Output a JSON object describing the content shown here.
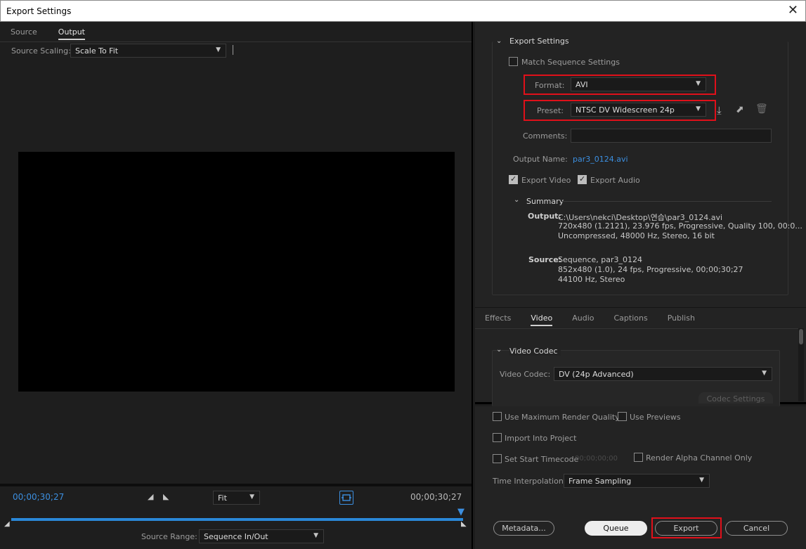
{
  "window": {
    "title": "Export Settings",
    "close_icon": "close-icon"
  },
  "left": {
    "tabs": [
      "Source",
      "Output"
    ],
    "active_tab": 1,
    "source_scaling_label": "Source Scaling:",
    "source_scaling_value": "Scale To Fit",
    "timecode_left": "00;00;30;27",
    "timecode_right": "00;00;30;27",
    "zoom_value": "Fit",
    "source_range_label": "Source Range:",
    "source_range_value": "Sequence In/Out"
  },
  "export_settings": {
    "section_title": "Export Settings",
    "match_sequence_label": "Match Sequence Settings",
    "format_label": "Format:",
    "format_value": "AVI",
    "preset_label": "Preset:",
    "preset_value": "NTSC DV Widescreen 24p",
    "comments_label": "Comments:",
    "comments_value": "",
    "output_name_label": "Output Name:",
    "output_name_value": "par3_0124.avi",
    "export_video_label": "Export Video",
    "export_audio_label": "Export Audio",
    "summary": {
      "title": "Summary",
      "output_label": "Output:",
      "output_lines": [
        "C:\\Users\\nekci\\Desktop\\연습\\par3_0124.avi",
        "720x480 (1.2121), 23.976 fps, Progressive, Quality 100, 00:0...",
        "Uncompressed, 48000 Hz, Stereo, 16 bit"
      ],
      "source_label": "Source:",
      "source_lines": [
        "Sequence, par3_0124",
        "852x480 (1.0), 24 fps, Progressive, 00;00;30;27",
        "44100 Hz, Stereo"
      ]
    }
  },
  "settings_tabs": {
    "items": [
      "Effects",
      "Video",
      "Audio",
      "Captions",
      "Publish"
    ],
    "active": 1
  },
  "video_codec": {
    "section_title": "Video Codec",
    "codec_label": "Video Codec:",
    "codec_value": "DV (24p Advanced)",
    "codec_settings_button": "Codec Settings"
  },
  "bottom": {
    "max_render_label": "Use Maximum Render Quality",
    "use_previews_label": "Use Previews",
    "import_project_label": "Import Into Project",
    "start_timecode_label": "Set Start Timecode",
    "start_timecode_value": "00;00;00;00",
    "render_alpha_label": "Render Alpha Channel Only",
    "time_interp_label": "Time Interpolation:",
    "time_interp_value": "Frame Sampling",
    "metadata_button": "Metadata...",
    "queue_button": "Queue",
    "export_button": "Export",
    "cancel_button": "Cancel"
  },
  "colors": {
    "accent_red": "#e0101a",
    "timecode_blue": "#3c8fe0",
    "progress_blue": "#2a88d8"
  }
}
